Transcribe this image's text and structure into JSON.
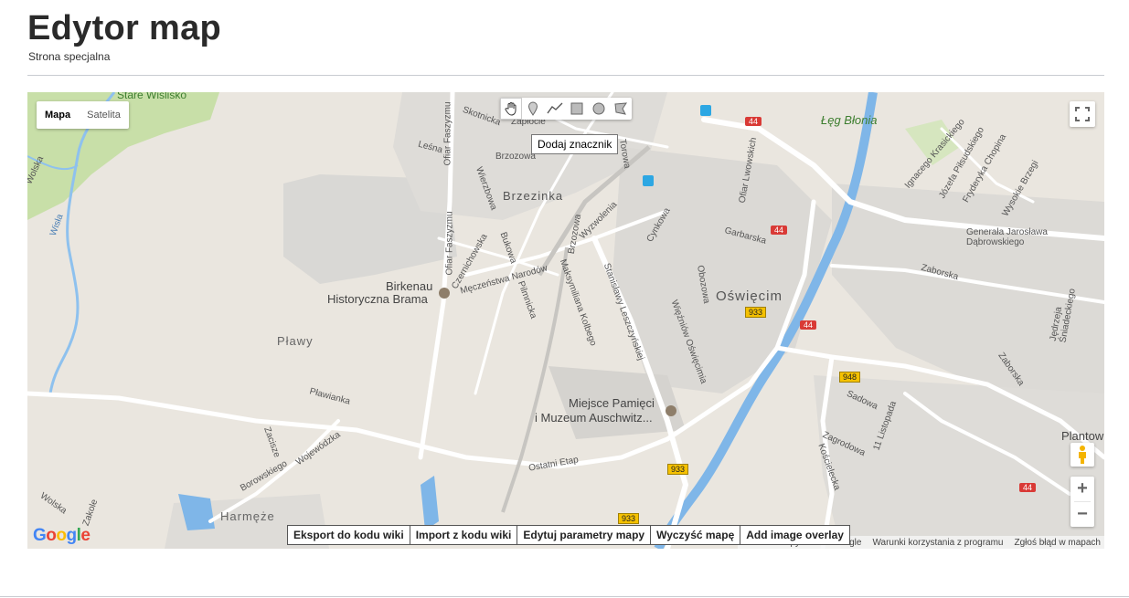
{
  "header": {
    "title": "Edytor map",
    "subtitle": "Strona specjalna"
  },
  "map": {
    "type_buttons": [
      "Mapa",
      "Satelita"
    ],
    "active_type": "Mapa",
    "tooltip": "Dodaj znacznik",
    "labels": {
      "stare_wislisko": "Stare Wiślisko",
      "leg_blonia": "Łęg Błonia",
      "brzezinka": "Brzezinka",
      "birkenau": "Birkenau",
      "historyczna_brama": "Historyczna Brama",
      "oswiecim": "Oświęcim",
      "plawy": "Pławy",
      "muzeum1": "Miejsce Pamięci",
      "muzeum2": "i Muzeum Auschwitz...",
      "harmeze": "Harmęże",
      "plantow": "Plantow",
      "wisla": "Wisła",
      "wolska": "Wolska",
      "skotnicka": "Skotnicka",
      "zaplocie": "Zapłocie",
      "lesna": "Leśna",
      "ofiar_faszyzmu": "Ofiar Faszyzmu",
      "ofiar_faszyzmu2": "Ofiar Faszyzmu",
      "brzozowa": "Brzozowa",
      "brzozowa2": "Brzozowa",
      "wierzbowa": "Wierzbowa",
      "czernichowska": "Czernichowska",
      "bukowa": "Bukowa",
      "meczenstwa": "Męczeństwa Narodów",
      "pilmnicka": "Pilmnicka",
      "wyzwolenia": "Wyzwolenia",
      "cynkowa": "Cynkowa",
      "garbarska": "Garbarska",
      "obozowa": "Obozowa",
      "ofiar_lwowskich": "Ofiar Lwowskich",
      "maksymiliana": "Maksymiliana Kolbego",
      "leszczynskiej": "Stanisławy Leszczyńskiej",
      "wiezniow": "Więźniów Oświęcimia",
      "torowa": "Torowa",
      "ignacego": "Ignacego Krasickiego",
      "pilsudskiego": "Józefa Piłsudskiego",
      "chopina": "Fryderyka Chopina",
      "wysokie_brzegi": "Wysokie Brzegi",
      "dabrowskiego": "Generała Jarosława Dąbrowskiego",
      "zaborska": "Zaborska",
      "zaborska2": "Zaborska",
      "sniadeckiego": "Jędrzeja Śniadeckiego",
      "sadowa": "Sadowa",
      "listopada": "11 Listopada",
      "zagrodowa": "Zagrodowa",
      "koscielecka": "Kościelecka",
      "plawianka": "Pławianka",
      "zacisze": "Zacisze",
      "wojewodzka": "Wojewódzka",
      "borowskiego": "Borowskiego",
      "ostatni_etap": "Ostatni Etap",
      "zakole": "Zakole",
      "wolska2": "Wolska"
    },
    "road_shields": [
      "44",
      "44",
      "44",
      "44",
      "933",
      "948",
      "933",
      "933"
    ],
    "google_logo": [
      "G",
      "o",
      "o",
      "g",
      "l",
      "e"
    ],
    "attribution": [
      "Dane do Mapy ©2018 Google",
      "Warunki korzystania z programu",
      "Zgłoś błąd w mapach"
    ],
    "zoom_in": "+",
    "zoom_out": "−"
  },
  "actions": {
    "export": "Eksport do kodu wiki",
    "import": "Import z kodu wiki",
    "edit_params": "Edytuj parametry mapy",
    "clear": "Wyczyść mapę",
    "add_overlay": "Add image overlay"
  },
  "colors": {
    "land": "#eae6df",
    "urban": "#dcdad6",
    "green": "#c8dfa8",
    "water": "#7fb6e8",
    "road": "#ffffff",
    "shield": "#f5c100",
    "red_shield": "#d93a36"
  },
  "icons": [
    "hand-icon",
    "marker-icon",
    "polyline-icon",
    "rectangle-icon",
    "circle-icon",
    "polygon-icon",
    "fullscreen-icon",
    "pegman-icon"
  ]
}
